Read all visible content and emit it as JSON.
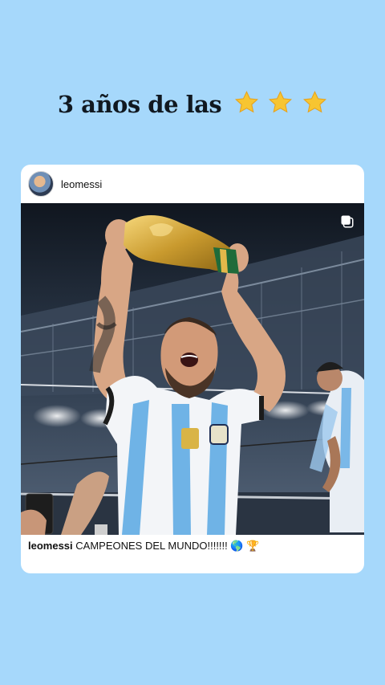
{
  "headline": {
    "text": "3 años de las",
    "star_count": 3,
    "star_icon": "star-emoji"
  },
  "post": {
    "username": "leomessi",
    "avatar_icon": "profile-avatar",
    "media_icon": "multiple-media-icon",
    "photo_alt_subject": "player-raising-trophy",
    "caption": {
      "username": "leomessi",
      "text": "CAMPEONES DEL MUNDO!!!!!!!",
      "emojis": "🌎 🏆"
    }
  },
  "colors": {
    "background": "#a6d8fb",
    "card": "#ffffff",
    "star_fill": "#f7c531",
    "jersey_blue": "#6fb3e6"
  }
}
